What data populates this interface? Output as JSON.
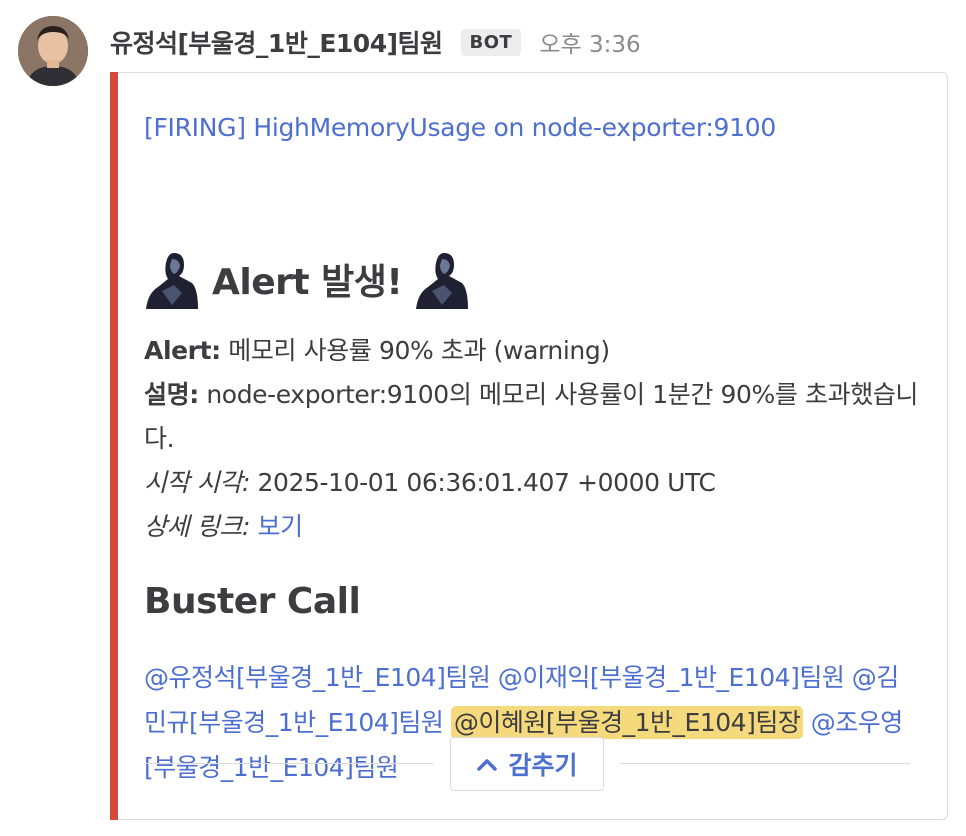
{
  "post": {
    "username": "유정석[부울경_1반_E104]팀원",
    "badge": "BOT",
    "time": "오후 3:36"
  },
  "attachment": {
    "color": "#d24b3a",
    "title": "[FIRING] HighMemoryUsage on node-exporter:9100",
    "heading": "Alert 발생!",
    "alert_label": "Alert:",
    "alert_value": " 메모리 사용률 90% 초과 (warning)",
    "desc_label": "설명:",
    "desc_value": " node-exporter:9100의 메모리 사용률이 1분간 90%를 초과했습니다.",
    "start_label": "시작 시각:",
    "start_value": " 2025-10-01 06:36:01.407 +0000 UTC",
    "link_label": "상세 링크:",
    "link_text": "보기",
    "section_heading": "Buster Call",
    "mentions": [
      "@유정석[부울경_1반_E104]팀원",
      "@이재익[부울경_1반_E104]팀원",
      "@김민규[부울경_1반_E104]팀원",
      "@이혜원[부울경_1반_E104]팀장",
      "@조우영[부울경_1반_E104]팀원"
    ],
    "collapse_label": "감추기"
  }
}
